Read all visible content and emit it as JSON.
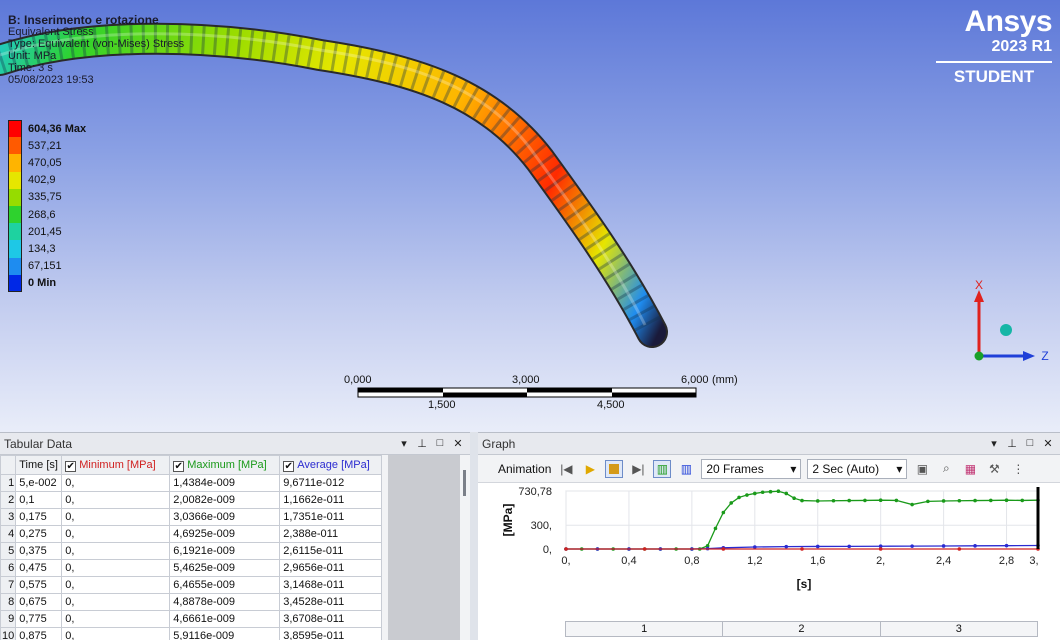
{
  "viewport": {
    "title": "B: Inserimento e rotazione",
    "subtitle": "Equivalent Stress",
    "type_line": "Type: Equivalent (von-Mises) Stress",
    "unit_line": "Unit: MPa",
    "time_line": "Time: 3 s",
    "date_line": "05/08/2023 19:53"
  },
  "legend": {
    "labels": [
      "604,36 Max",
      "537,21",
      "470,05",
      "402,9",
      "335,75",
      "268,6",
      "201,45",
      "134,3",
      "67,151",
      "0 Min"
    ],
    "colors": [
      "#ff0000",
      "#ff5a00",
      "#ffb400",
      "#e6e600",
      "#96dc00",
      "#2ed22e",
      "#1ed2a0",
      "#1ec8e6",
      "#1e8cf0",
      "#0028e6"
    ]
  },
  "brand": {
    "name": "Ansys",
    "version": "2023 R1",
    "edition": "STUDENT"
  },
  "axes": {
    "x": "X",
    "z": "Z"
  },
  "scale_bar": {
    "top": [
      "0,000",
      "3,000",
      "6,000"
    ],
    "unit": "(mm)",
    "bottom": [
      "1,500",
      "4,500"
    ]
  },
  "tabular": {
    "title": "Tabular Data",
    "headers": [
      "Time [s]",
      "Minimum [MPa]",
      "Maximum [MPa]",
      "Average [MPa]"
    ],
    "header_colors": [
      "#111111",
      "#d02020",
      "#1a9a1a",
      "#2b2bd0"
    ],
    "rows": [
      [
        "1",
        "5,e-002",
        "0,",
        "1,4384e-009",
        "9,6711e-012"
      ],
      [
        "2",
        "0,1",
        "0,",
        "2,0082e-009",
        "1,1662e-011"
      ],
      [
        "3",
        "0,175",
        "0,",
        "3,0366e-009",
        "1,7351e-011"
      ],
      [
        "4",
        "0,275",
        "0,",
        "4,6925e-009",
        "2,388e-011"
      ],
      [
        "5",
        "0,375",
        "0,",
        "6,1921e-009",
        "2,6115e-011"
      ],
      [
        "6",
        "0,475",
        "0,",
        "5,4625e-009",
        "2,9656e-011"
      ],
      [
        "7",
        "0,575",
        "0,",
        "6,4655e-009",
        "3,1468e-011"
      ],
      [
        "8",
        "0,675",
        "0,",
        "4,8878e-009",
        "3,4528e-011"
      ],
      [
        "9",
        "0,775",
        "0,",
        "4,6661e-009",
        "3,6708e-011"
      ],
      [
        "10",
        "0,875",
        "0,",
        "5,9116e-009",
        "3,8595e-011"
      ]
    ]
  },
  "graph": {
    "title": "Graph",
    "animation_label": "Animation",
    "frames": "20 Frames",
    "duration": "2 Sec (Auto)",
    "cursor_label": "3,",
    "timeline": [
      "1",
      "2",
      "3"
    ]
  },
  "chart_data": {
    "type": "line",
    "ylabel": "[MPa]",
    "xlabel": "[s]",
    "xlim": [
      0,
      3
    ],
    "ylim": [
      0,
      730.78
    ],
    "x_ticks": [
      "0,",
      "0,4",
      "0,8",
      "1,2",
      "1,6",
      "2,",
      "2,4",
      "2,8",
      "3,"
    ],
    "y_ticks": [
      "0,",
      "300,",
      "730,78"
    ],
    "series": [
      {
        "color": "#1a9a1a",
        "x": [
          0,
          0.1,
          0.2,
          0.3,
          0.4,
          0.5,
          0.6,
          0.7,
          0.8,
          0.85,
          0.9,
          0.95,
          1.0,
          1.05,
          1.1,
          1.15,
          1.2,
          1.25,
          1.3,
          1.35,
          1.4,
          1.45,
          1.5,
          1.6,
          1.7,
          1.8,
          1.9,
          2.0,
          2.1,
          2.2,
          2.3,
          2.4,
          2.5,
          2.6,
          2.7,
          2.8,
          2.9,
          3.0
        ],
        "values": [
          0,
          0,
          0,
          0,
          0,
          0,
          0,
          0,
          0,
          0,
          40,
          260,
          460,
          580,
          650,
          680,
          700,
          715,
          722,
          728,
          700,
          640,
          610,
          605,
          608,
          610,
          612,
          615,
          612,
          560,
          600,
          605,
          608,
          610,
          612,
          615,
          612,
          615
        ]
      },
      {
        "color": "#2b2bd0",
        "x": [
          0,
          0.2,
          0.4,
          0.6,
          0.8,
          0.9,
          1.0,
          1.2,
          1.4,
          1.6,
          1.8,
          2.0,
          2.2,
          2.4,
          2.6,
          2.8,
          3.0
        ],
        "values": [
          0,
          0,
          0,
          0,
          0,
          5,
          15,
          25,
          30,
          32,
          33,
          35,
          36,
          38,
          40,
          42,
          44
        ]
      },
      {
        "color": "#d02020",
        "x": [
          0,
          0.5,
          1.0,
          1.5,
          2.0,
          2.5,
          3.0
        ],
        "values": [
          0,
          0,
          0,
          0,
          0,
          0,
          0
        ]
      }
    ]
  }
}
